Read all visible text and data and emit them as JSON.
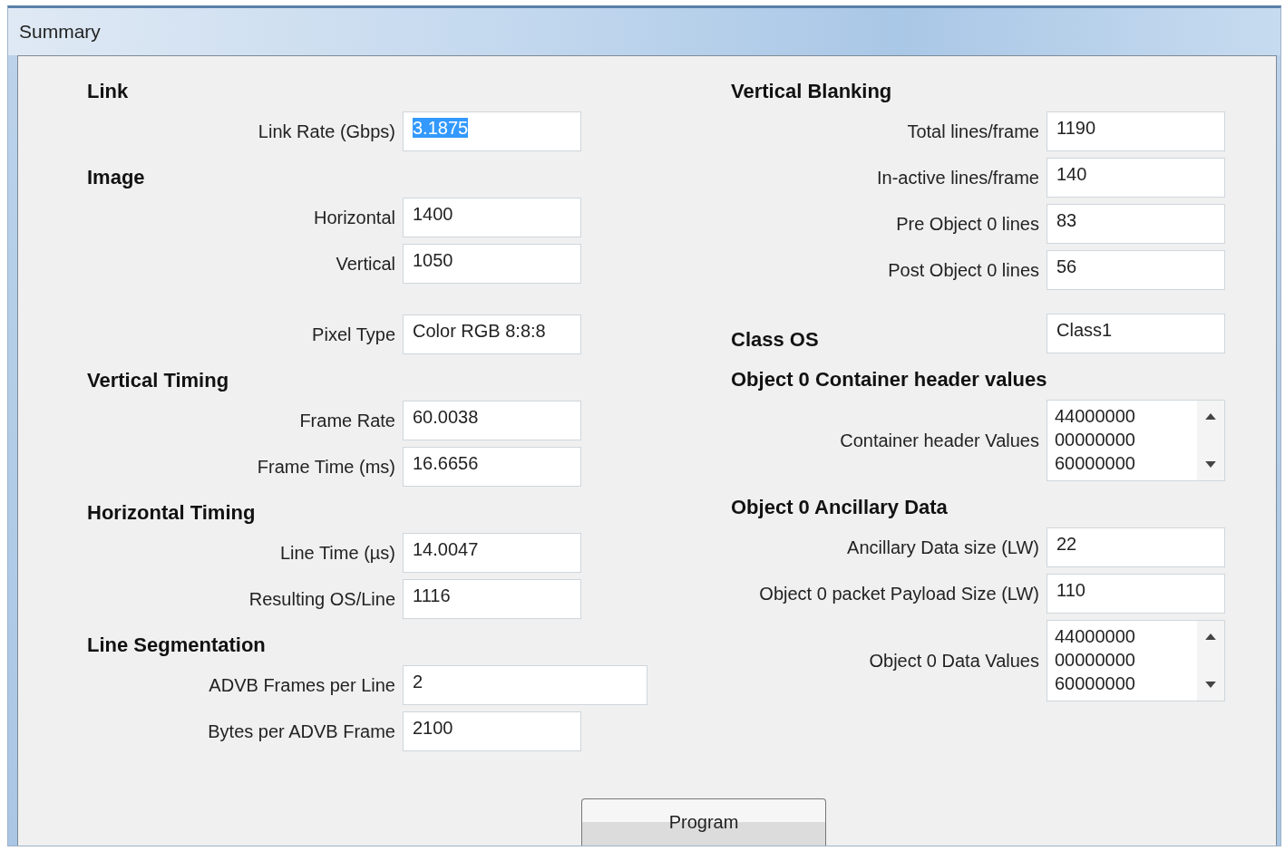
{
  "window": {
    "title": "Summary"
  },
  "columns": [
    {
      "sections": [
        {
          "heading": "Link",
          "rows": [
            {
              "kind": "text",
              "label": "Link Rate (Gbps)",
              "value": "3.1875",
              "selected": true
            }
          ]
        },
        {
          "heading": "Image",
          "rows": [
            {
              "kind": "text",
              "label": "Horizontal",
              "value": "1400",
              "selected": false
            },
            {
              "kind": "text",
              "label": "Vertical",
              "value": "1050",
              "selected": false
            }
          ]
        },
        {
          "rows": [
            {
              "kind": "text",
              "label": "Pixel Type",
              "value": "Color RGB 8:8:8",
              "selected": false
            }
          ]
        },
        {
          "heading": "Vertical Timing",
          "rows": [
            {
              "kind": "text",
              "label": "Frame Rate",
              "value": "60.0038",
              "selected": false
            },
            {
              "kind": "text",
              "label": "Frame Time (ms)",
              "value": "16.6656",
              "selected": false
            }
          ]
        },
        {
          "heading": "Horizontal Timing",
          "rows": [
            {
              "kind": "text",
              "label": "Line Time (µs)",
              "value": "14.0047",
              "selected": false
            },
            {
              "kind": "text",
              "label": "Resulting OS/Line",
              "value": "1116",
              "selected": false
            }
          ]
        },
        {
          "heading": "Line Segmentation",
          "rows": [
            {
              "kind": "wide",
              "label": "ADVB Frames per Line",
              "value": "2",
              "selected": false
            },
            {
              "kind": "text",
              "label": "Bytes per ADVB Frame",
              "value": "2100",
              "selected": false
            }
          ]
        }
      ]
    },
    {
      "sections": [
        {
          "heading": "Vertical Blanking",
          "rows": [
            {
              "kind": "text",
              "label": "Total lines/frame",
              "value": "1190",
              "selected": false
            },
            {
              "kind": "text",
              "label": "In-active lines/frame",
              "value": "140",
              "selected": false
            },
            {
              "kind": "text",
              "label": "Pre Object 0 lines",
              "value": "83",
              "selected": false
            },
            {
              "kind": "text",
              "label": "Post Object 0 lines",
              "value": "56",
              "selected": false
            }
          ]
        },
        {
          "heading": "Class OS",
          "inline": true,
          "rows": [
            {
              "kind": "text",
              "value": "Class1",
              "selected": false
            }
          ]
        },
        {
          "heading": "Object 0 Container header values",
          "rows": [
            {
              "kind": "list",
              "label": "Container header Values",
              "values": [
                "44000000",
                "00000000",
                "60000000"
              ]
            }
          ]
        },
        {
          "heading": "Object 0 Ancillary Data",
          "rows": [
            {
              "kind": "text",
              "label": "Ancillary Data size (LW)",
              "value": "22",
              "selected": false
            },
            {
              "kind": "text",
              "label": "Object 0 packet Payload Size (LW)",
              "value": "110",
              "selected": false
            },
            {
              "kind": "list",
              "label": "Object 0 Data Values",
              "values": [
                "44000000",
                "00000000",
                "60000000"
              ]
            }
          ]
        }
      ]
    }
  ],
  "button": "Program"
}
